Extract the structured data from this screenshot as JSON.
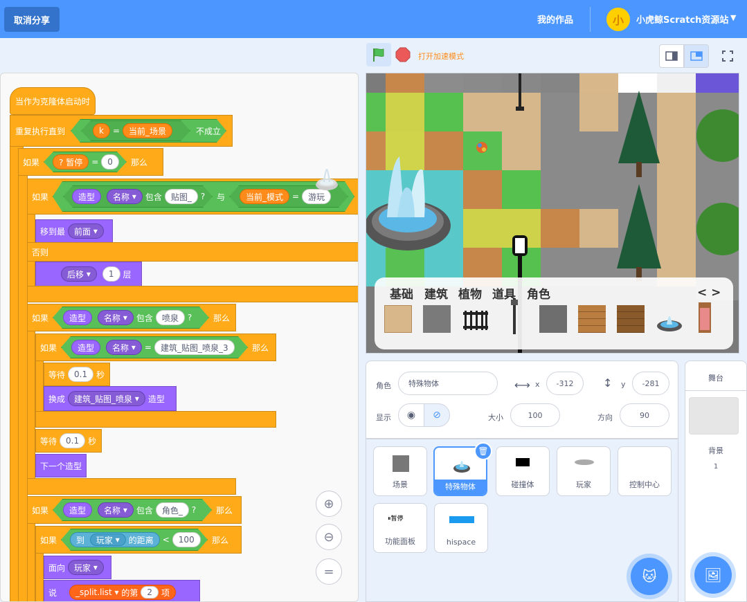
{
  "topbar": {
    "unshare": "取消分享",
    "my_works": "我的作品",
    "username": "小虎鲸Scratch资源站"
  },
  "stagebar": {
    "turbo": "打开加速模式"
  },
  "code": {
    "hat": "当作为克隆体启动时",
    "repeat_until": "重复执行直到",
    "var_k": "k",
    "eq": "=",
    "cur_scene": "当前_场景",
    "not_hold": "不成立",
    "if": "如果",
    "pause": "? 暂停",
    "zero": "0",
    "then": "那么",
    "costume": "造型",
    "name": "名称",
    "contains": "包含",
    "tile_prefix": "贴图_",
    "q": "?",
    "and": "与",
    "cur_mode": "当前_模式",
    "play": "游玩",
    "goto_layer": "移到最",
    "front": "前面",
    "else": "否则",
    "back": "后移",
    "one": "1",
    "layers": "层",
    "fountain": "喷泉",
    "fountain3": "建筑_贴图_喷泉_3",
    "wait": "等待",
    "p01": "0.1",
    "sec": "秒",
    "switch": "换成",
    "fountain_costume": "建筑_贴图_喷泉",
    "costume2": "造型",
    "next_costume": "下一个造型",
    "role": "角色_",
    "to": "到",
    "player": "玩家",
    "distance": "的距离",
    "lt": "<",
    "hundred": "100",
    "face": "面向",
    "say": "说",
    "split_list": "_split.list",
    "item_of": "的第",
    "two": "2",
    "item": "项"
  },
  "palette": {
    "tabs": [
      "基础",
      "建筑",
      "植物",
      "道具",
      "角色"
    ],
    "nav": "< >"
  },
  "sprite_info": {
    "sprite_label": "角色",
    "sprite_name": "特殊物体",
    "x_label": "x",
    "x": "-312",
    "y_label": "y",
    "y": "-281",
    "show_label": "显示",
    "size_label": "大小",
    "size": "100",
    "dir_label": "方向",
    "dir": "90"
  },
  "sprites": [
    {
      "name": "场景"
    },
    {
      "name": "特殊物体"
    },
    {
      "name": "碰撞体"
    },
    {
      "name": "玩家"
    },
    {
      "name": "控制中心"
    },
    {
      "name": "功能面板"
    },
    {
      "name": "hispace"
    }
  ],
  "pause_icon_text": "暂停",
  "stage_panel": {
    "title": "舞台",
    "backdrop_label": "背景",
    "backdrop_count": "1"
  },
  "colors": {
    "accent": "#4c97ff",
    "control": "#ffab19",
    "looks": "#9966ff",
    "operators": "#59c059"
  }
}
